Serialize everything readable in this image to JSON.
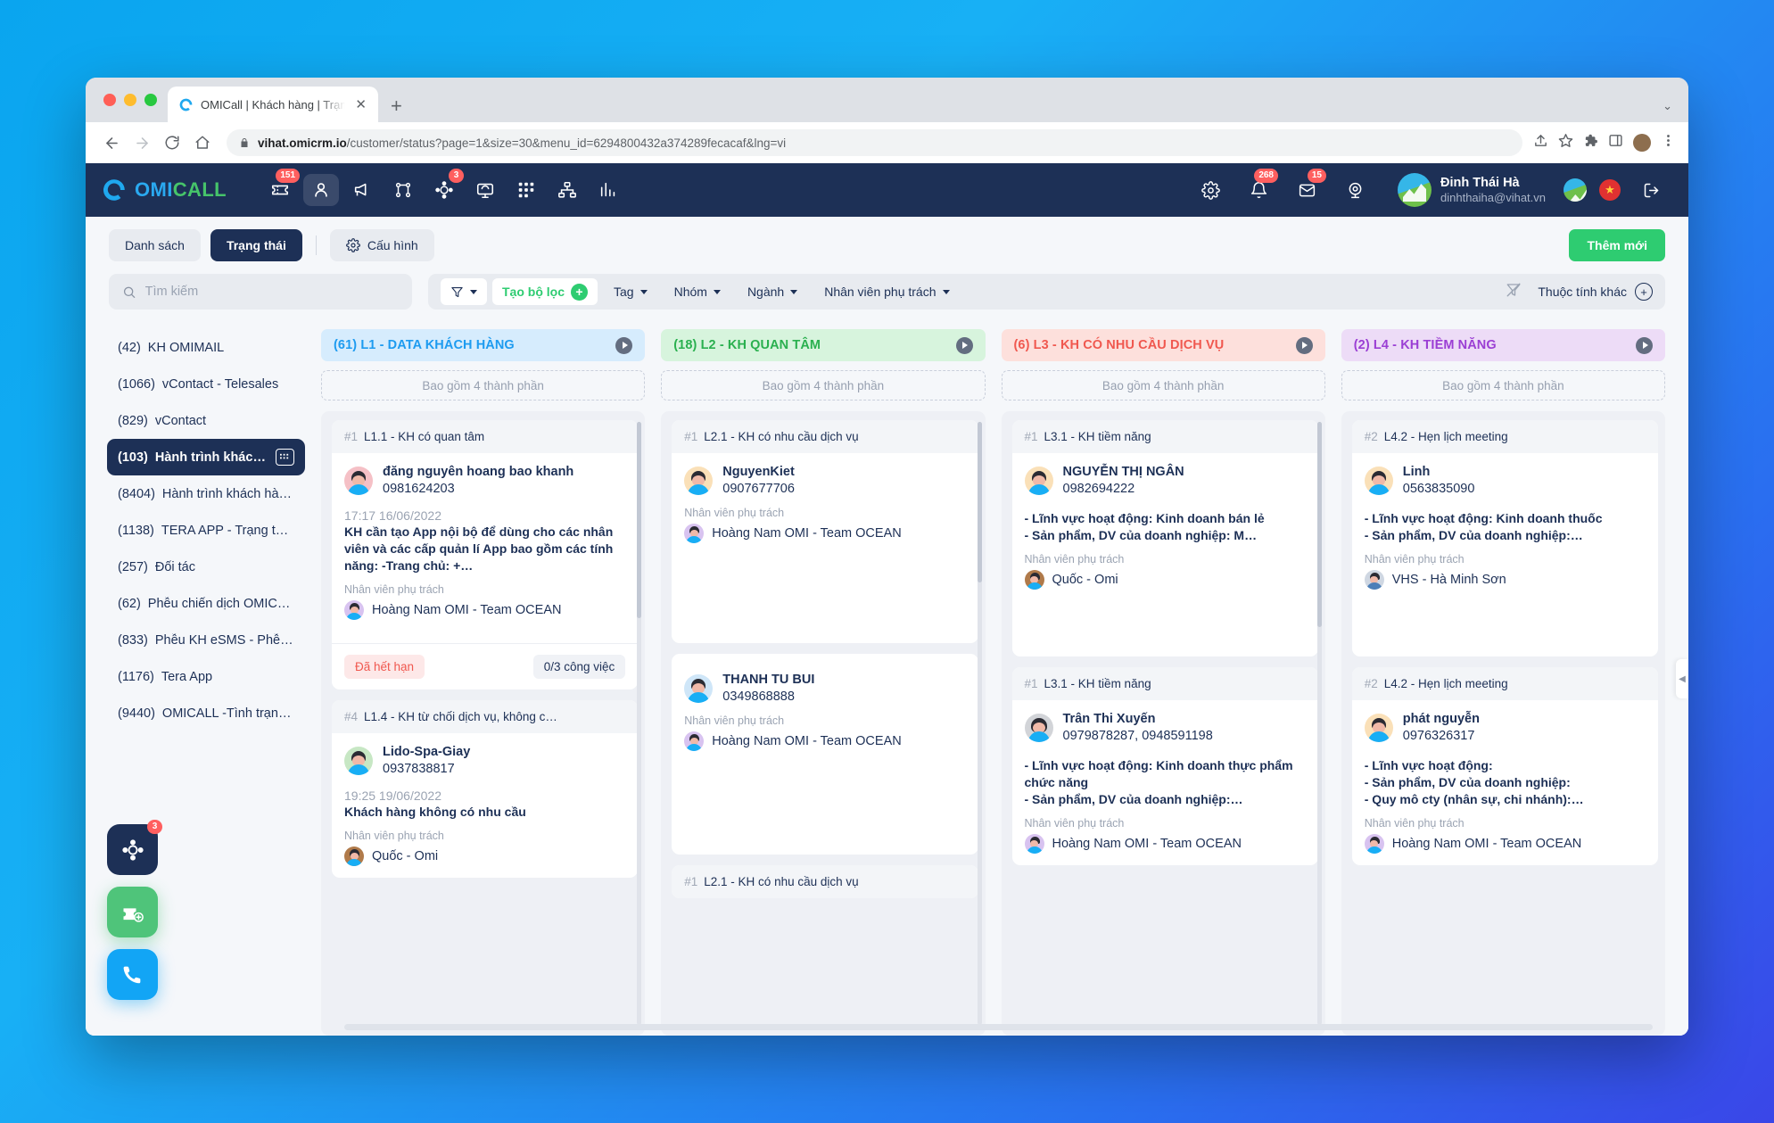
{
  "browser": {
    "tab_title": "OMICall | Khách hàng | Trạng th",
    "new_tab": "+",
    "url_host": "vihat.omicrm.io",
    "url_path": "/customer/status?page=1&size=30&menu_id=6294800432a374289fecacaf&lng=vi"
  },
  "topnav": {
    "logo": {
      "part1": "OMI",
      "part2": "CALL"
    },
    "icons": [
      {
        "name": "ticket-icon",
        "badge": "151"
      },
      {
        "name": "contact-icon",
        "badge": ""
      },
      {
        "name": "campaign-icon",
        "badge": ""
      },
      {
        "name": "workflow-icon",
        "badge": ""
      },
      {
        "name": "automation-icon",
        "badge": "3"
      },
      {
        "name": "monitor-icon",
        "badge": ""
      },
      {
        "name": "apps-icon",
        "badge": ""
      },
      {
        "name": "hierarchy-icon",
        "badge": ""
      },
      {
        "name": "report-icon",
        "badge": ""
      }
    ],
    "right_icons": [
      {
        "name": "gear-icon",
        "badge": ""
      },
      {
        "name": "bell-icon",
        "badge": "268"
      },
      {
        "name": "mail-icon",
        "badge": "15"
      },
      {
        "name": "webcam-icon",
        "badge": ""
      }
    ],
    "profile": {
      "name": "Đinh Thái Hà",
      "email": "dinhthaiha@vihat.vn"
    },
    "flag": "★",
    "logout": "logout-icon"
  },
  "toolbar": {
    "tab_list": "Danh sách",
    "tab_status": "Trạng thái",
    "tab_config": "Cấu hình",
    "add_new": "Thêm mới"
  },
  "filters": {
    "search_placeholder": "Tìm kiếm",
    "search_value": "",
    "create_filter": "Tạo bộ lọc",
    "tag": "Tag",
    "group": "Nhóm",
    "industry": "Ngành",
    "assignee": "Nhân viên phụ trách",
    "other_attributes": "Thuộc tính khác"
  },
  "sidebar": {
    "items": [
      {
        "count": "(42)",
        "label": "KH OMIMAIL",
        "active": false
      },
      {
        "count": "(1066)",
        "label": "vContact - Telesales",
        "active": false
      },
      {
        "count": "(829)",
        "label": "vContact",
        "active": false
      },
      {
        "count": "(103)",
        "label": "Hành trình khách hàng…",
        "active": true
      },
      {
        "count": "(8404)",
        "label": "Hành trình khách hàng …",
        "active": false
      },
      {
        "count": "(1138)",
        "label": "TERA APP - Trạng thái k…",
        "active": false
      },
      {
        "count": "(257)",
        "label": "Đối tác",
        "active": false
      },
      {
        "count": "(62)",
        "label": "Phễu chiến dịch OMICALL -…",
        "active": false
      },
      {
        "count": "(833)",
        "label": "Phễu KH eSMS - Phễu Ac…",
        "active": false
      },
      {
        "count": "(1176)",
        "label": "Tera App",
        "active": false
      },
      {
        "count": "(9440)",
        "label": "OMICALL -Tình trạng KH…",
        "active": false
      }
    ]
  },
  "fab": {
    "workflow_badge": "3",
    "workflow": "workflow-fab",
    "ticket": "add-ticket-fab",
    "call": "call-fab"
  },
  "board": {
    "sub_label": "Bao gồm 4 thành phần",
    "assignee_label": "Nhân viên phụ trách",
    "columns": [
      {
        "title": "(61) L1 - DATA KHÁCH HÀNG",
        "bg": "#d6ecfd",
        "color": "#1d9bf0",
        "cards": [
          {
            "num": "#1",
            "head": "L1.1 - KH có quan tâm",
            "name": "đăng nguyên hoang bao khanh",
            "phone": "0981624203",
            "time": "17:17 16/06/2022",
            "desc": "KH cần tạo App nội bộ để dùng cho các nhân viên và các cấp quản lí App bao gồm các tính năng: -Trang chủ: +…",
            "assignee": "Hoàng Nam OMI - Team OCEAN",
            "avatar_skin": "#f5c0c6",
            "assignee_avatar": "#d8c3f0",
            "footer": {
              "expired": "Đã hết hạn",
              "tasks": "0/3 công việc"
            }
          },
          {
            "num": "#4",
            "head": "L1.4 - KH từ chối dịch vụ, không c…",
            "name": "Lido-Spa-Giay",
            "phone": "0937838817",
            "time": "19:25 19/06/2022",
            "desc": "Khách hàng không có nhu cầu",
            "assignee": "Quốc - Omi",
            "avatar_skin": "#c7e7c4",
            "assignee_avatar": "#b07a4a",
            "footer": null
          }
        ]
      },
      {
        "title": "(18) L2 - KH QUAN TÂM",
        "bg": "#d7f4dd",
        "color": "#2ab04f",
        "cards": [
          {
            "num": "#1",
            "head": "L2.1 - KH có nhu cầu dịch vụ",
            "name": "NguyenKiet",
            "phone": "0907677706",
            "time": "",
            "desc": "",
            "assignee": "Hoàng Nam OMI - Team OCEAN",
            "avatar_skin": "#fae0b8",
            "assignee_avatar": "#d8c3f0",
            "footer": null,
            "tall": true
          },
          {
            "num": "",
            "head": "",
            "name": "THANH TU BUI",
            "phone": "0349868888",
            "time": "",
            "desc": "",
            "assignee": "Hoàng Nam OMI - Team OCEAN",
            "avatar_skin": "#cfe6f8",
            "assignee_avatar": "#d8c3f0",
            "footer": null,
            "tall": true
          },
          {
            "num": "#1",
            "head": "L2.1 - KH có nhu cầu dịch vụ",
            "name": "",
            "phone": "",
            "time": "",
            "desc": "",
            "assignee": "",
            "partial": true
          }
        ]
      },
      {
        "title": "(6) L3 - KH CÓ NHU CẦU DỊCH VỤ",
        "bg": "#fde0dc",
        "color": "#f0584f",
        "cards": [
          {
            "num": "#1",
            "head": "L3.1 - KH tiềm năng",
            "name": "NGUYỄN THỊ NGÂN",
            "phone": "0982694222",
            "time": "",
            "desc": "- Lĩnh vực hoạt động: Kinh doanh bán lẻ\n- Sản phẩm, DV của doanh nghiệp: M…",
            "assignee": "Quốc - Omi",
            "avatar_skin": "#fae0b8",
            "assignee_avatar": "#b07a4a",
            "footer": null
          },
          {
            "num": "#1",
            "head": "L3.1 - KH tiềm năng",
            "name": "Trân Thi Xuyến",
            "phone": "0979878287, 0948591198",
            "time": "",
            "desc": "- Lĩnh vực hoạt động: Kinh doanh thực phẩm chức năng\n- Sản phẩm, DV của doanh nghiệp:…",
            "assignee": "Hoàng Nam OMI - Team OCEAN",
            "avatar_skin": "#d2d4d8",
            "assignee_avatar": "#d8c3f0",
            "footer": null
          }
        ]
      },
      {
        "title": "(2) L4 - KH TIỀM NĂNG",
        "bg": "#eddcf7",
        "color": "#9b3fd4",
        "cards": [
          {
            "num": "#2",
            "head": "L4.2 - Hẹn lịch meeting",
            "name": "Linh",
            "phone": "0563835090",
            "time": "",
            "desc": "- Lĩnh vực hoạt động: Kinh doanh thuốc\n- Sản phẩm, DV của doanh nghiệp:…",
            "assignee": "VHS - Hà Minh Sơn",
            "avatar_skin": "#fae0b8",
            "assignee_avatar": "#cfd7e2",
            "footer": null
          },
          {
            "num": "#2",
            "head": "L4.2 - Hẹn lịch meeting",
            "name": "phát nguyễn",
            "phone": "0976326317",
            "time": "",
            "desc": "- Lĩnh vực hoạt động:\n- Sản phẩm, DV của doanh nghiệp:\n- Quy mô cty (nhân sự, chi nhánh):…",
            "assignee": "Hoàng Nam OMI - Team OCEAN",
            "avatar_skin": "#fae0b8",
            "assignee_avatar": "#d8c3f0",
            "footer": null
          }
        ]
      }
    ]
  }
}
